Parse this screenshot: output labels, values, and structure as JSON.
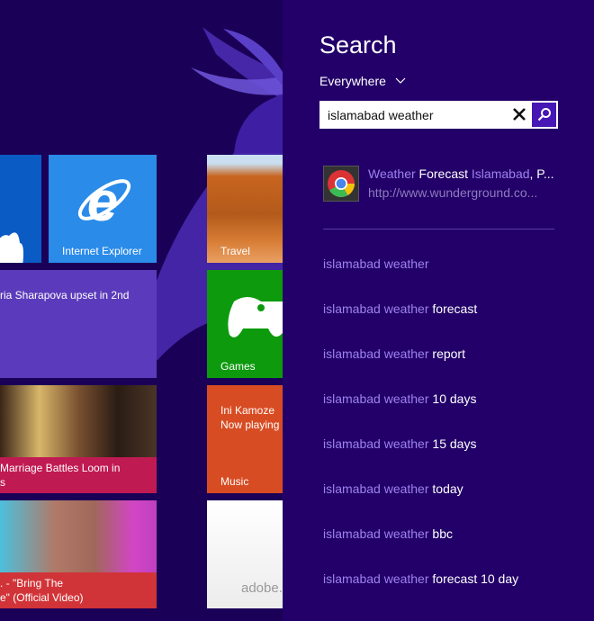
{
  "start_screen": {
    "tiles": {
      "onedrive": {
        "label": "",
        "color": "#0a5bc4"
      },
      "ie": {
        "label": "Internet Explorer",
        "color": "#2a8be9"
      },
      "travel": {
        "label": "Travel"
      },
      "news": {
        "headline": "ria Sharapova upset in 2nd",
        "color": "#5b3bbb"
      },
      "games": {
        "label": "Games",
        "color": "#0d9a0d"
      },
      "news2": {
        "headline_line1": "Marriage Battles Loom in",
        "headline_line2": "s",
        "color": "#c01a52"
      },
      "music": {
        "artist": "Ini Kamoze",
        "status": "Now playing",
        "label": "Music",
        "color": "#d84c23"
      },
      "video": {
        "title_line1": ". - \"Bring The",
        "title_line2": "e\" (Official Video)",
        "color": "#d13438"
      },
      "adobe": {
        "label": "adobe."
      }
    }
  },
  "search_pane": {
    "title": "Search",
    "scope": "Everywhere",
    "query": "islamabad weather",
    "top_result": {
      "title_parts": [
        {
          "text": "Weather",
          "match": true
        },
        {
          "text": " Forecast ",
          "match": false
        },
        {
          "text": "Islamabad",
          "match": true
        },
        {
          "text": ", P...",
          "match": false
        }
      ],
      "url": "http://www.wunderground.co...",
      "app_icon": "chrome-icon"
    },
    "suggestions": [
      {
        "match": "islamabad weather",
        "rest": ""
      },
      {
        "match": "islamabad weather",
        "rest": " forecast"
      },
      {
        "match": "islamabad weather",
        "rest": " report"
      },
      {
        "match": "islamabad weather",
        "rest": " 10 days"
      },
      {
        "match": "islamabad weather",
        "rest": " 15 days"
      },
      {
        "match": "islamabad weather",
        "rest": " today"
      },
      {
        "match": "islamabad weather",
        "rest": " bbc"
      },
      {
        "match": "islamabad weather",
        "rest": " forecast 10 day"
      }
    ]
  }
}
